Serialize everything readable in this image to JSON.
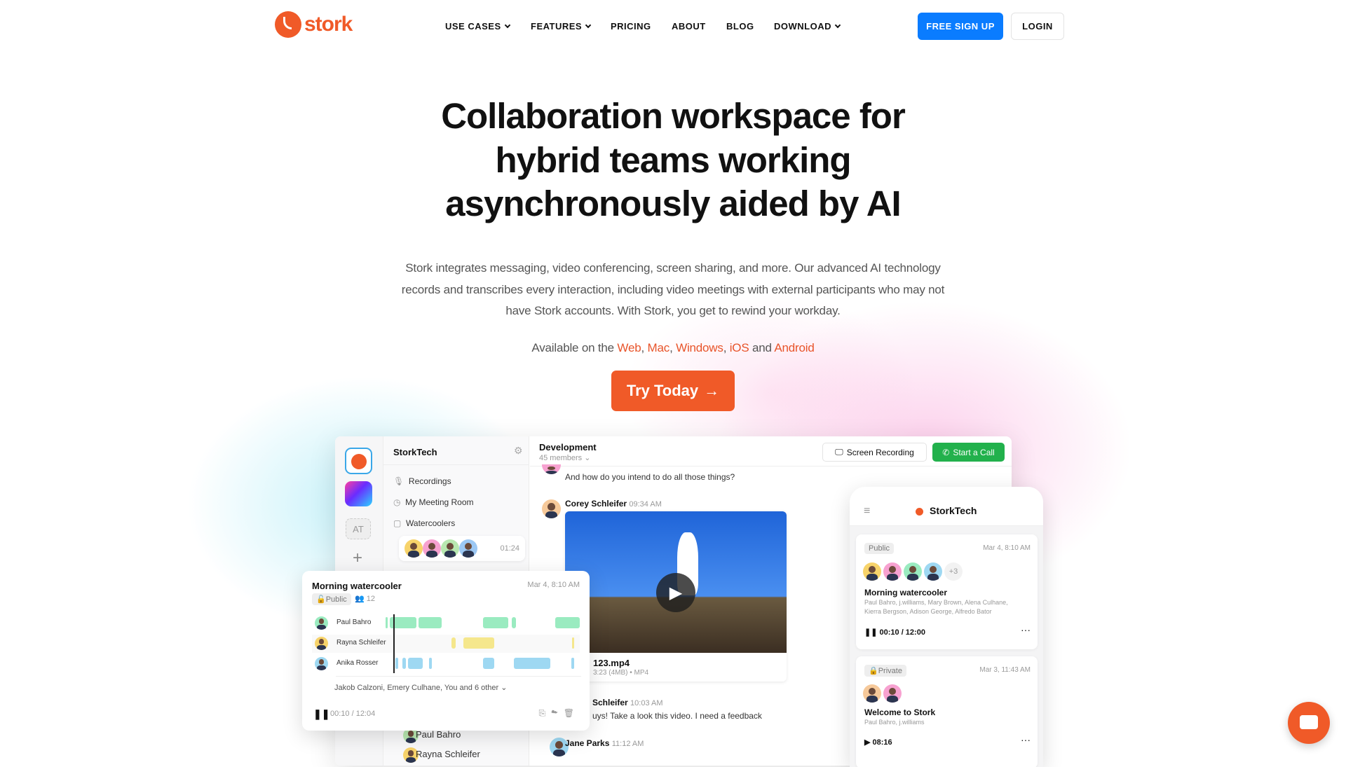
{
  "brand": {
    "name": "stork",
    "color": "#f05a28"
  },
  "nav": {
    "items": [
      {
        "label": "USE CASES",
        "dropdown": true
      },
      {
        "label": "FEATURES",
        "dropdown": true
      },
      {
        "label": "PRICING"
      },
      {
        "label": "ABOUT"
      },
      {
        "label": "BLOG"
      },
      {
        "label": "DOWNLOAD",
        "dropdown": true
      }
    ],
    "signup": "FREE SIGN UP",
    "login": "LOGIN"
  },
  "hero": {
    "title_lines": [
      "Collaboration workspace for",
      "hybrid teams working",
      "asynchronously aided by AI"
    ],
    "description_lines": [
      "Stork integrates messaging, video conferencing, screen sharing, and more. Our advanced AI technology",
      "records and transcribes every interaction, including video meetings with external participants who may not",
      "have Stork accounts. With Stork, you get to rewind your workday."
    ],
    "available_prefix": "Available on the",
    "platforms": [
      "Web",
      "Mac",
      "Windows",
      "iOS",
      "Android"
    ],
    "and": "and",
    "cta": "Try Today"
  },
  "app": {
    "workspace": "StorkTech",
    "workspace_initials": "AT",
    "channels": [
      "Recordings",
      "My Meeting Room",
      "Watercoolers"
    ],
    "watercooler_time": "01:24",
    "channel": {
      "name": "Development",
      "members": "45 members"
    },
    "screen_recording": "Screen Recording",
    "start_call": "Start a Call",
    "messages": [
      {
        "text": "And how do you intend to do all those things?"
      },
      {
        "author": "Corey Schleifer",
        "time": "09:34 AM",
        "file": {
          "name": "123.mp4",
          "meta": "3:23 (4MB) • MP4"
        }
      },
      {
        "author": "Schleifer",
        "time": "10:03 AM",
        "text": "uys! Take a look this video. I need a feedback"
      },
      {
        "author": "Jane Parks",
        "time": "11:12 AM"
      }
    ],
    "member_list": [
      "Paul Bahro",
      "Rayna Schleifer"
    ]
  },
  "recording_card": {
    "title": "Morning watercooler",
    "date": "Mar 4, 8:10 AM",
    "visibility": "Public",
    "participants_count": "12",
    "playhead": 0.04,
    "tracks": [
      {
        "name": "Paul Bahro",
        "color": "#9aebc0",
        "segments": [
          [
            0,
            0.01
          ],
          [
            0.02,
            0.16
          ],
          [
            0.17,
            0.29
          ],
          [
            0.5,
            0.63
          ],
          [
            0.65,
            0.67
          ],
          [
            0.875,
            1
          ]
        ]
      },
      {
        "name": "Rayna Schleifer",
        "color": "#f5e78c",
        "segments": [
          [
            0.34,
            0.36
          ],
          [
            0.4,
            0.56
          ],
          [
            0.96,
            0.965
          ]
        ]
      },
      {
        "name": "Anika Rosser",
        "color": "#9ed8f2",
        "segments": [
          [
            0.05,
            0.064
          ],
          [
            0.087,
            0.106
          ],
          [
            0.115,
            0.19
          ],
          [
            0.224,
            0.24
          ],
          [
            0.5,
            0.56
          ],
          [
            0.66,
            0.85
          ],
          [
            0.957,
            0.97
          ]
        ]
      }
    ],
    "others": "Jakob Calzoni, Emery Culhane, You and 6 other",
    "time": "00:10 / 12:04"
  },
  "mobile": {
    "title": "StorkTech",
    "cards": [
      {
        "visibility": "Public",
        "date": "Mar 4, 8:10 AM",
        "extra": "+3",
        "title": "Morning watercooler",
        "members_lines": [
          "Paul Bahro, j.williams, Mary Brown, Alena Culhane,",
          "Kierra Bergson, Adison George, Alfredo Bator"
        ],
        "time": "00:10 / 12:00"
      },
      {
        "visibility": "Private",
        "date": "Mar 3, 11:43 AM",
        "title": "Welcome to Stork",
        "members_lines": [
          "Paul Bahro, j.williams"
        ],
        "time": "08:16"
      }
    ]
  },
  "colors": {
    "accent": "#f05a28",
    "primary": "#0a7cff",
    "call": "#22b14c"
  }
}
